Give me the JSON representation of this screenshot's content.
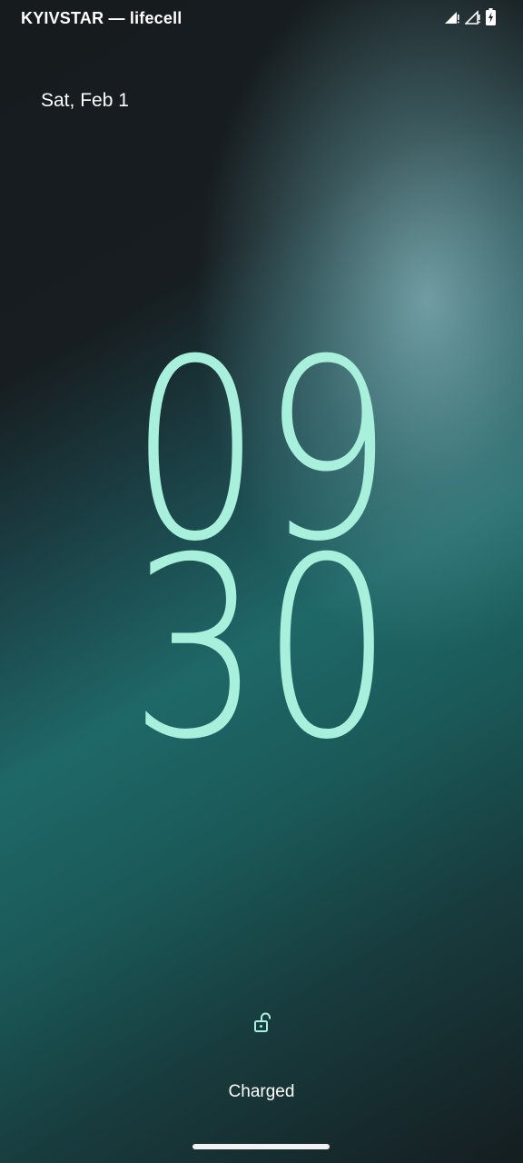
{
  "status_bar": {
    "carrier": "KYIVSTAR — lifecell",
    "icons": [
      "signal-sim1-icon",
      "signal-sim2-icon",
      "battery-charging-icon"
    ]
  },
  "lockscreen": {
    "date": "Sat, Feb 1",
    "clock": {
      "hour": "09",
      "minute": "30",
      "color": "#a8f0dc"
    },
    "lock_icon": "unlocked-padlock-icon",
    "charging_status": "Charged"
  },
  "navigation": {
    "handle": "gesture-nav-handle"
  }
}
